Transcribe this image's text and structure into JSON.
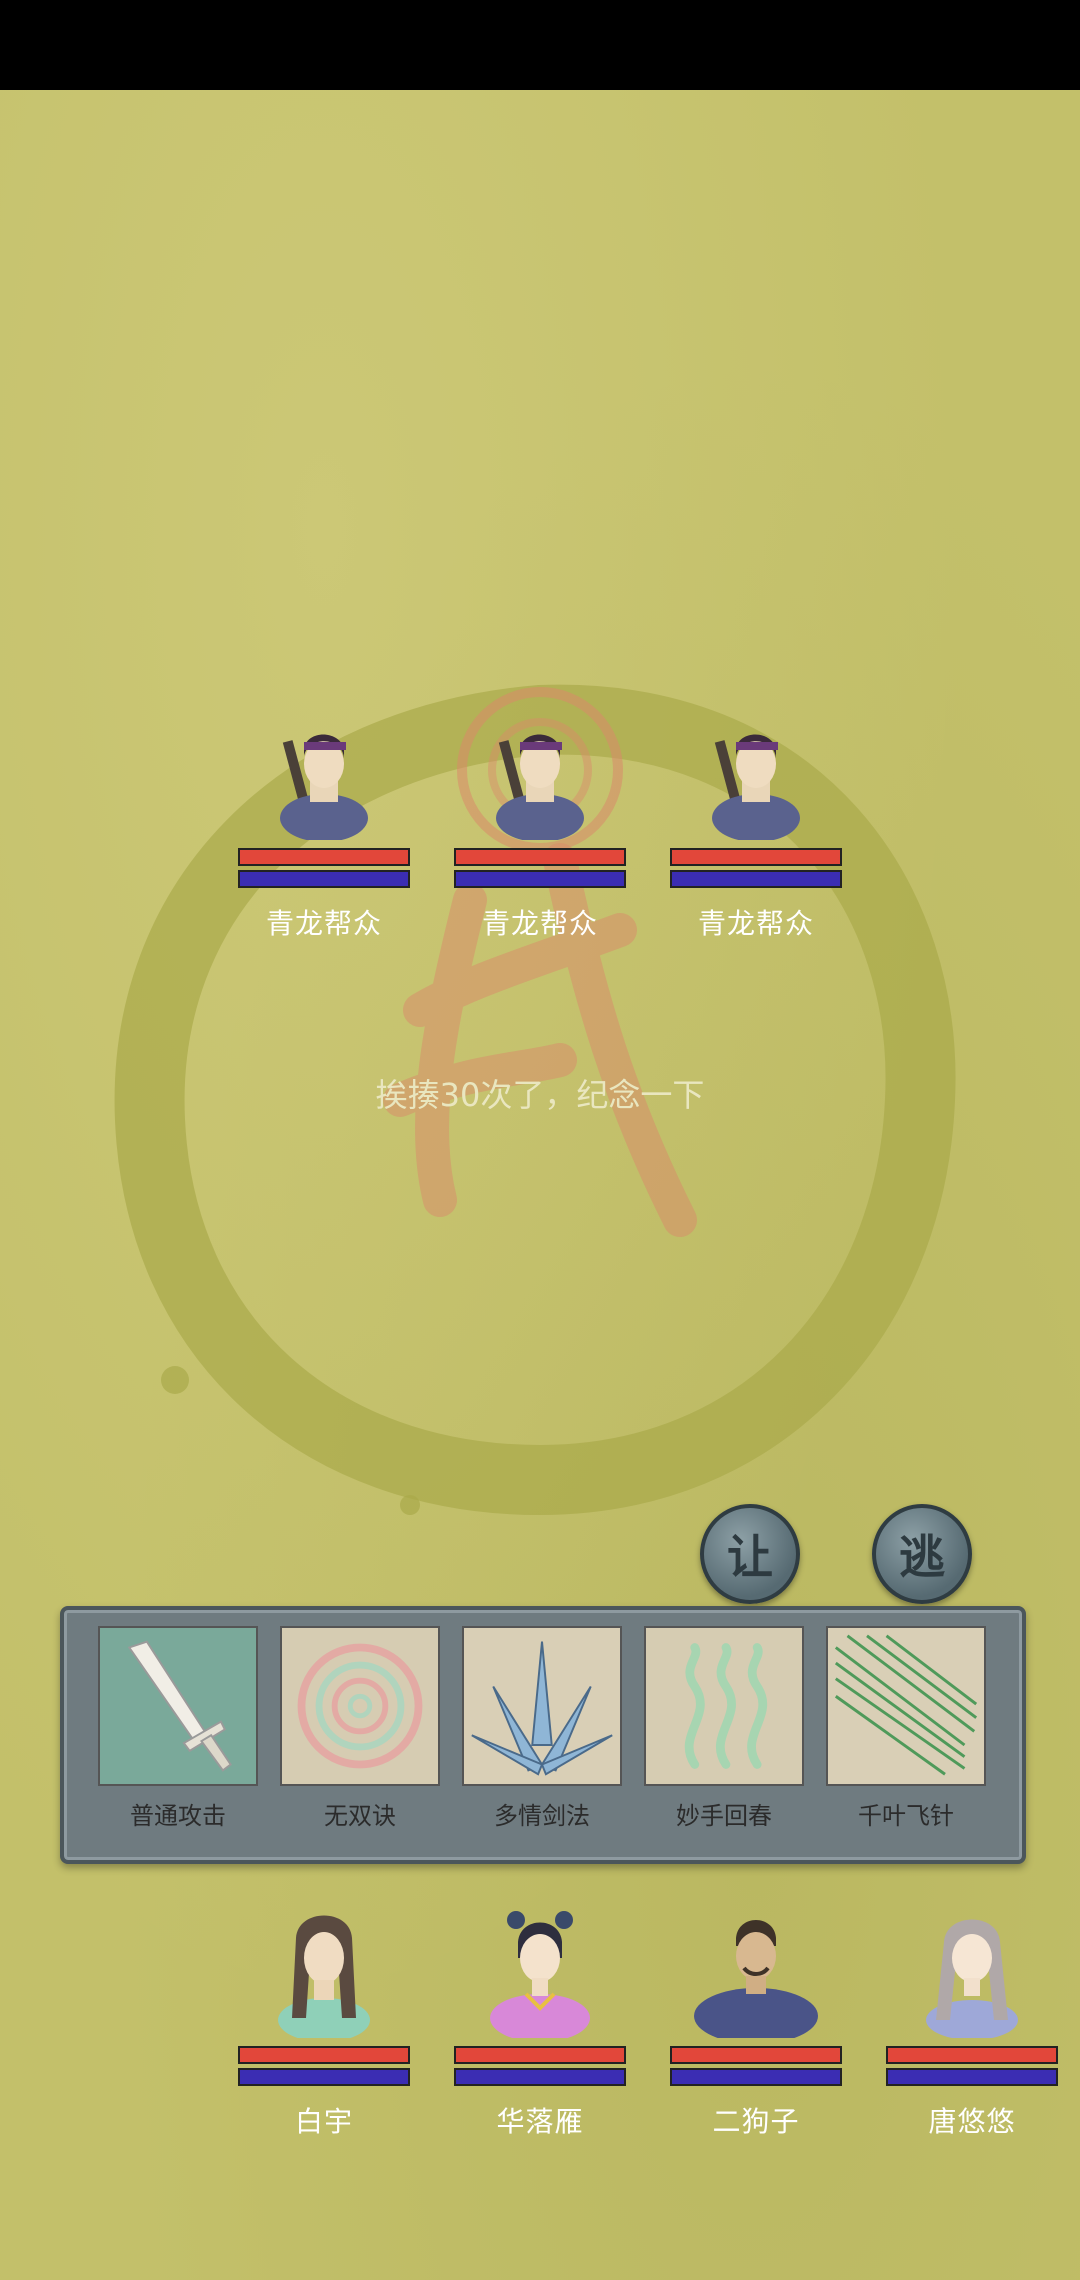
{
  "message": "挨揍30次了，纪念一下",
  "enemies": [
    {
      "name": "青龙帮众",
      "hp": 1.0,
      "mp": 1.0
    },
    {
      "name": "青龙帮众",
      "hp": 1.0,
      "mp": 1.0
    },
    {
      "name": "青龙帮众",
      "hp": 1.0,
      "mp": 1.0
    }
  ],
  "actions": {
    "yield_label": "让",
    "flee_label": "逃"
  },
  "skills": [
    {
      "label": "普通攻击",
      "icon": "sword-icon"
    },
    {
      "label": "无双诀",
      "icon": "swirl-icon"
    },
    {
      "label": "多情剑法",
      "icon": "multi-sword-icon"
    },
    {
      "label": "妙手回春",
      "icon": "healing-icon"
    },
    {
      "label": "千叶飞针",
      "icon": "needles-icon"
    }
  ],
  "party": [
    {
      "name": "白宇",
      "hp": 1.0,
      "mp": 1.0
    },
    {
      "name": "华落雁",
      "hp": 1.0,
      "mp": 1.0
    },
    {
      "name": "二狗子",
      "hp": 1.0,
      "mp": 1.0
    },
    {
      "name": "唐悠悠",
      "hp": 1.0,
      "mp": 1.0
    }
  ],
  "colors": {
    "background": "#c3c06a",
    "hp_bar": "#e2473a",
    "mp_bar": "#3b2db3"
  }
}
